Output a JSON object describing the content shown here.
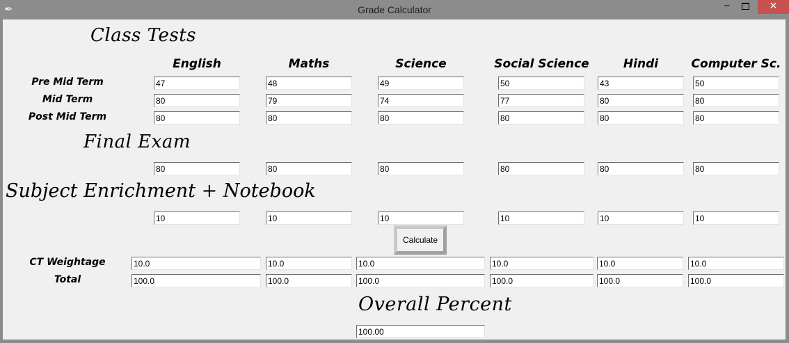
{
  "window": {
    "title": "Grade Calculator",
    "app_icon": "feather-icon",
    "minimize_glyph": "‒",
    "close_glyph": "✕"
  },
  "headings": {
    "class_tests": "Class Tests",
    "final_exam": "Final Exam",
    "subject_enrichment": "Subject Enrichment + Notebook",
    "overall_percent": "Overall Percent"
  },
  "subjects": [
    "English",
    "Maths",
    "Science",
    "Social Science",
    "Hindi",
    "Computer Sc."
  ],
  "row_labels": {
    "pre_mid_term": "Pre Mid Term",
    "mid_term": "Mid Term",
    "post_mid_term": "Post Mid Term",
    "ct_weightage": "CT Weightage",
    "total": "Total"
  },
  "inputs": {
    "pre_mid_term": [
      "47",
      "48",
      "49",
      "50",
      "43",
      "50"
    ],
    "mid_term": [
      "80",
      "79",
      "74",
      "77",
      "80",
      "80"
    ],
    "post_mid_term": [
      "80",
      "80",
      "80",
      "80",
      "80",
      "80"
    ],
    "final_exam": [
      "80",
      "80",
      "80",
      "80",
      "80",
      "80"
    ],
    "subject_enrichment": [
      "10",
      "10",
      "10",
      "10",
      "10",
      "10"
    ]
  },
  "calculate_label": "Calculate",
  "results": {
    "ct_weightage": [
      "10.0",
      "10.0",
      "10.0",
      "10.0",
      "10.0",
      "10.0"
    ],
    "total": [
      "100.0",
      "100.0",
      "100.0",
      "100.0",
      "100.0",
      "100.0"
    ],
    "overall_percent": "100.00"
  }
}
